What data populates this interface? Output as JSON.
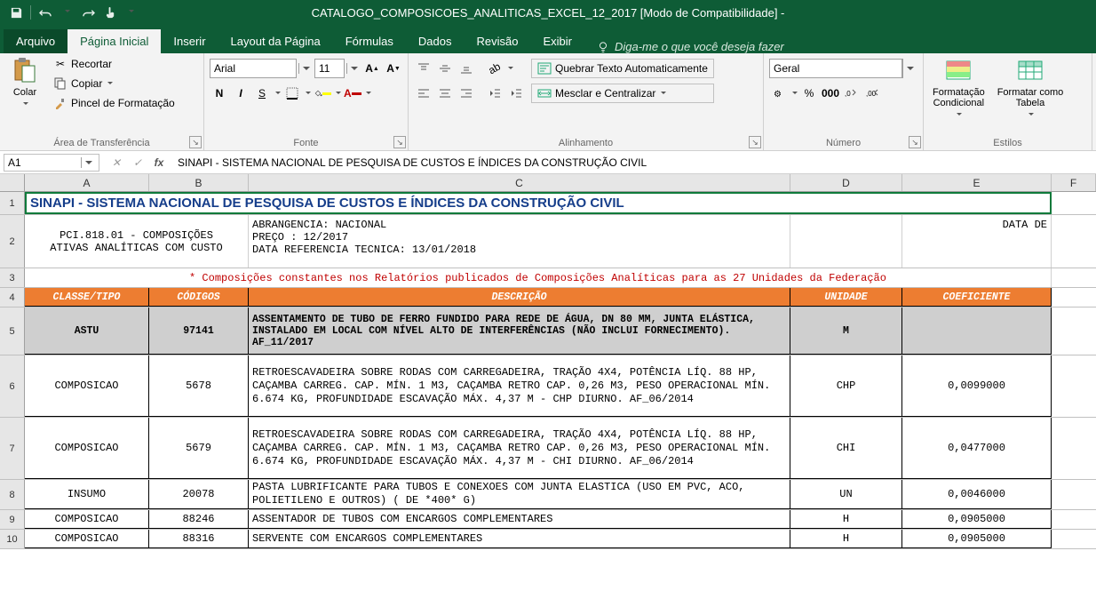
{
  "titlebar": {
    "title": "CATALOGO_COMPOSICOES_ANALITICAS_EXCEL_12_2017  [Modo de Compatibilidade]  -"
  },
  "tabs": {
    "file": "Arquivo",
    "items": [
      "Página Inicial",
      "Inserir",
      "Layout da Página",
      "Fórmulas",
      "Dados",
      "Revisão",
      "Exibir"
    ],
    "active": 0,
    "tellme": "Diga-me o que você deseja fazer"
  },
  "ribbon": {
    "clipboard": {
      "paste": "Colar",
      "cut": "Recortar",
      "copy": "Copiar",
      "painter": "Pincel de Formatação",
      "label": "Área de Transferência"
    },
    "font": {
      "name": "Arial",
      "size": "11",
      "label": "Fonte"
    },
    "align": {
      "wrap": "Quebrar Texto Automaticamente",
      "merge": "Mesclar e Centralizar",
      "label": "Alinhamento"
    },
    "number": {
      "format": "Geral",
      "label": "Número"
    },
    "styles": {
      "condfmt": "Formatação\nCondicional",
      "fmttable": "Formatar como\nTabela",
      "label": "Estilos"
    }
  },
  "namebox": "A1",
  "formula": "SINAPI - SISTEMA NACIONAL DE PESQUISA DE CUSTOS E ÍNDICES DA CONSTRUÇÃO CIVIL",
  "columns": [
    "A",
    "B",
    "C",
    "D",
    "E",
    "F"
  ],
  "sheet": {
    "r1": "SINAPI - SISTEMA NACIONAL DE PESQUISA DE CUSTOS E ÍNDICES DA CONSTRUÇÃO CIVIL",
    "r2_ab": "PCI.818.01 - COMPOSIÇÕES\nATIVAS ANALÍTICAS COM CUSTO",
    "r2_c": "ABRANGENCIA: NACIONAL\nPREÇO           :  12/2017\nDATA REFERENCIA TECNICA: 13/01/2018",
    "r2_e": "DATA DE",
    "r3": "* Composições constantes nos Relatórios publicados de Composições Analíticas para as 27 Unidades da Federação",
    "headers": {
      "a": "CLASSE/TIPO",
      "b": "CÓDIGOS",
      "c": "DESCRIÇÃO",
      "d": "UNIDADE",
      "e": "COEFICIENTE"
    },
    "r5": {
      "a": "ASTU",
      "b": "97141",
      "c": "ASSENTAMENTO DE TUBO DE FERRO FUNDIDO PARA REDE DE ÁGUA, DN 80 MM, JUNTA ELÁSTICA, INSTALADO EM LOCAL COM NÍVEL ALTO DE INTERFERÊNCIAS (NÃO INCLUI FORNECIMENTO). AF_11/2017",
      "d": "M",
      "e": ""
    },
    "data": [
      {
        "a": "COMPOSICAO",
        "b": "5678",
        "c": "RETROESCAVADEIRA SOBRE RODAS COM CARREGADEIRA, TRAÇÃO 4X4, POTÊNCIA LÍQ. 88 HP, CAÇAMBA CARREG. CAP. MÍN. 1 M3, CAÇAMBA RETRO CAP. 0,26 M3, PESO OPERACIONAL MÍN. 6.674 KG, PROFUNDIDADE ESCAVAÇÃO MÁX. 4,37 M - CHP DIURNO. AF_06/2014",
        "d": "CHP",
        "e": "0,0099000"
      },
      {
        "a": "COMPOSICAO",
        "b": "5679",
        "c": "RETROESCAVADEIRA SOBRE RODAS COM CARREGADEIRA, TRAÇÃO 4X4, POTÊNCIA LÍQ. 88 HP, CAÇAMBA CARREG. CAP. MÍN. 1 M3, CAÇAMBA RETRO CAP. 0,26 M3, PESO OPERACIONAL MÍN. 6.674 KG, PROFUNDIDADE ESCAVAÇÃO MÁX. 4,37 M - CHI DIURNO. AF_06/2014",
        "d": "CHI",
        "e": "0,0477000"
      },
      {
        "a": "INSUMO",
        "b": "20078",
        "c": "PASTA LUBRIFICANTE PARA TUBOS E CONEXOES COM JUNTA ELASTICA (USO EM PVC, ACO, POLIETILENO E OUTROS) ( DE *400* G)",
        "d": "UN",
        "e": "0,0046000"
      },
      {
        "a": "COMPOSICAO",
        "b": "88246",
        "c": "ASSENTADOR DE TUBOS COM ENCARGOS COMPLEMENTARES",
        "d": "H",
        "e": "0,0905000"
      },
      {
        "a": "COMPOSICAO",
        "b": "88316",
        "c": "SERVENTE COM ENCARGOS COMPLEMENTARES",
        "d": "H",
        "e": "0,0905000"
      }
    ]
  }
}
